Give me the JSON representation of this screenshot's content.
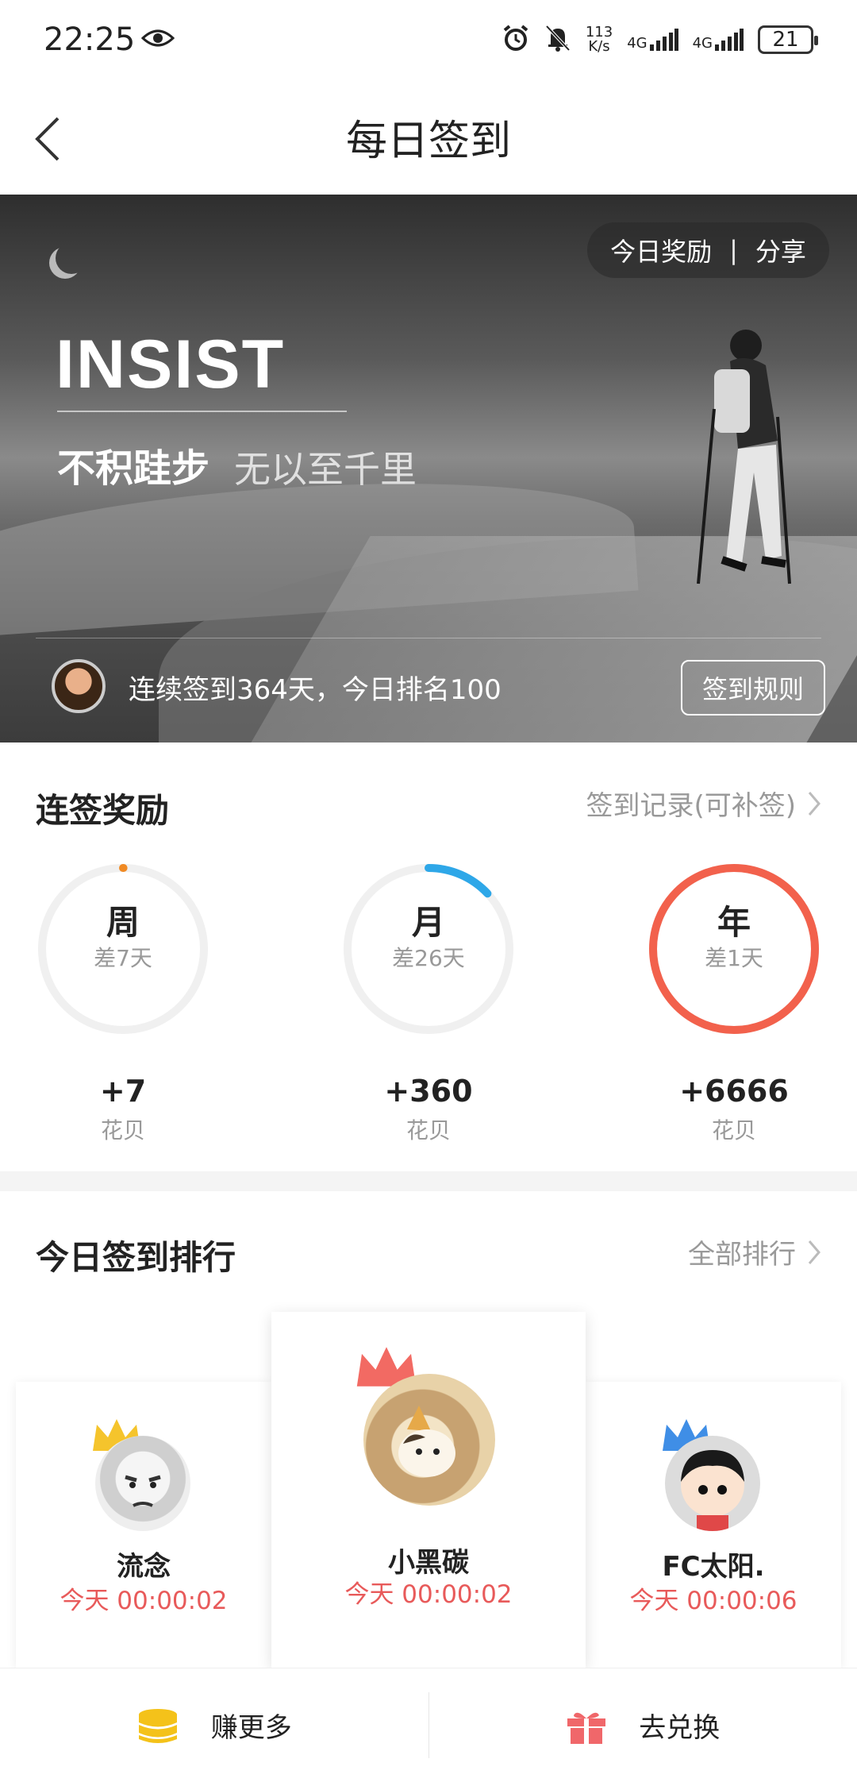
{
  "status_bar": {
    "time": "22:25",
    "net_speed_top": "113",
    "net_speed_bottom": "K/s",
    "sig1": "4G",
    "sig2": "4G",
    "battery": "21"
  },
  "nav": {
    "title": "每日签到"
  },
  "hero": {
    "reward_label": "今日奖励",
    "share_label": "分享",
    "separator": "|",
    "headline": "INSIST",
    "slogan_primary": "不积跬步",
    "slogan_secondary": "无以至千里",
    "streak_text": "连续签到364天，今日排名100",
    "rules_label": "签到规则"
  },
  "rewards": {
    "title": "连签奖励",
    "record_link": "签到记录(可补签)",
    "items": [
      {
        "label": "周",
        "sub": "差7天",
        "points": "+7",
        "unit": "花贝",
        "progress": 0.0,
        "color": "#f08a24"
      },
      {
        "label": "月",
        "sub": "差26天",
        "points": "+360",
        "unit": "花贝",
        "progress": 0.13,
        "color": "#2ea7e8"
      },
      {
        "label": "年",
        "sub": "差1天",
        "points": "+6666",
        "unit": "花贝",
        "progress": 1.0,
        "color": "#f2614c"
      }
    ]
  },
  "ranking": {
    "title": "今日签到排行",
    "all_link": "全部排行",
    "users": [
      {
        "rank": 2,
        "name": "流念",
        "time": "今天 00:00:02",
        "crown_color": "#f5c42c"
      },
      {
        "rank": 1,
        "name": "小黑碳",
        "time": "今天 00:00:02",
        "crown_color": "#f26a63"
      },
      {
        "rank": 3,
        "name": "FC太阳.",
        "time": "今天 00:00:06",
        "crown_color": "#3f8ee6"
      }
    ]
  },
  "bottom": {
    "earn_label": "赚更多",
    "exchange_label": "去兑换"
  }
}
